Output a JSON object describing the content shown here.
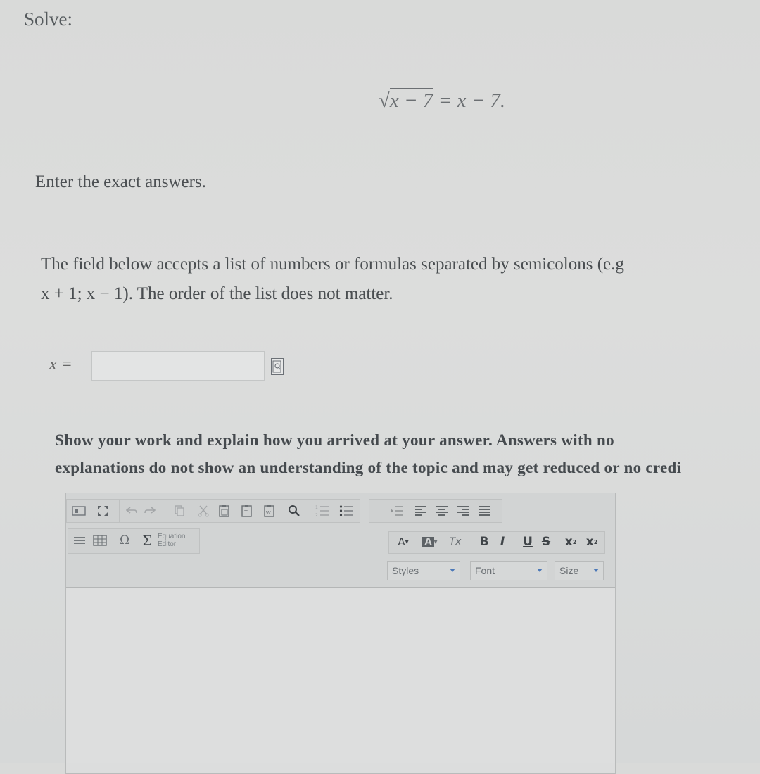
{
  "problem": {
    "solve_label": "Solve:",
    "equation_radicand": "x − 7",
    "equation_rhs": " = x − 7.",
    "instruction": "Enter the exact answers."
  },
  "field_note": {
    "line1": "The field below accepts a list of numbers or formulas separated by semicolons (e.g",
    "line2": "x + 1; x − 1). The order of the list does not matter."
  },
  "answer": {
    "label": "x =",
    "value": "",
    "preview_icon": "formula-preview-icon"
  },
  "work_prompt": {
    "line1": "Show your work and explain how you arrived at your answer. Answers with no",
    "line2": "explanations do not show an understanding of the topic and may get reduced or no credi"
  },
  "editor": {
    "toolbar_row1": [
      "source-icon",
      "maximize-icon",
      "undo-icon",
      "redo-icon",
      "copy-icon",
      "cut-icon",
      "paste-icon",
      "paste-text-icon",
      "paste-word-icon",
      "find-icon",
      "numbered-list-icon",
      "bulleted-list-icon",
      "indent-icon",
      "align-left-icon",
      "align-center-icon",
      "align-right-icon",
      "justify-icon"
    ],
    "toolbar_row2": {
      "special_char": "Ω",
      "sigma": "Σ",
      "equation_editor_line1": "Equation",
      "equation_editor_line2": "Editor",
      "text_color": "A",
      "bg_color": "A",
      "remove_format": "Tx",
      "bold": "B",
      "italic": "I",
      "underline": "U",
      "strike": "S",
      "subscript": "x",
      "superscript": "x"
    },
    "styles_label": "Styles",
    "font_label": "Font",
    "size_label": "Size"
  },
  "colors": {
    "background": "#d9dad9",
    "text": "#3f4346",
    "dropdown_arrow": "#4c79b8"
  }
}
